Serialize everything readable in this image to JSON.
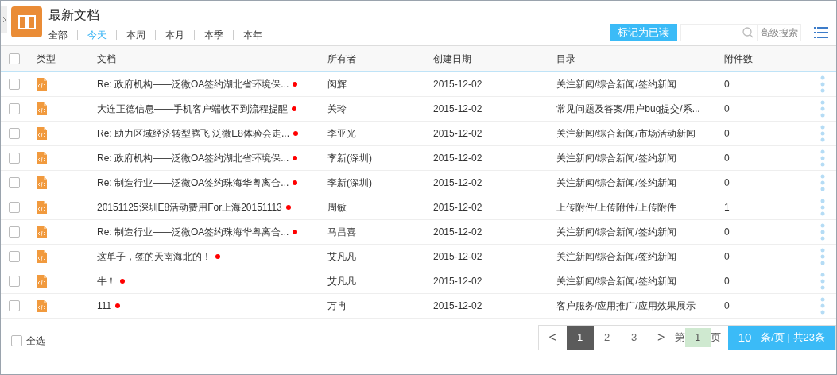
{
  "header": {
    "title": "最新文档",
    "filters": [
      {
        "label": "全部",
        "selected": false
      },
      {
        "label": "今天",
        "selected": true
      },
      {
        "label": "本周",
        "selected": false
      },
      {
        "label": "本月",
        "selected": false
      },
      {
        "label": "本季",
        "selected": false
      },
      {
        "label": "本年",
        "selected": false
      }
    ],
    "mark_read_button": "标记为已读",
    "advanced_search": "高级搜索"
  },
  "table": {
    "select_all_checked": false,
    "columns": [
      "类型",
      "文档",
      "所有者",
      "创建日期",
      "目录",
      "附件数"
    ],
    "rows": [
      {
        "checked": false,
        "title": "Re: 政府机构——泛微OA签约湖北省环境保...",
        "unread": true,
        "owner": "闵辉",
        "date": "2015-12-02",
        "directory": "关注新闻/综合新闻/签约新闻",
        "attachments": "0"
      },
      {
        "checked": false,
        "title": "大连正德信息——手机客户端收不到流程提醒",
        "unread": true,
        "owner": "关玲",
        "date": "2015-12-02",
        "directory": "常见问题及答案/用户bug提交/系...",
        "attachments": "0"
      },
      {
        "checked": false,
        "title": "Re: 助力区域经济转型腾飞 泛微E8体验会走...",
        "unread": true,
        "owner": "李亚光",
        "date": "2015-12-02",
        "directory": "关注新闻/综合新闻/市场活动新闻",
        "attachments": "0"
      },
      {
        "checked": false,
        "title": "Re: 政府机构——泛微OA签约湖北省环境保...",
        "unread": true,
        "owner": "李新(深圳)",
        "date": "2015-12-02",
        "directory": "关注新闻/综合新闻/签约新闻",
        "attachments": "0"
      },
      {
        "checked": false,
        "title": "Re: 制造行业——泛微OA签约珠海华粤离合...",
        "unread": true,
        "owner": "李新(深圳)",
        "date": "2015-12-02",
        "directory": "关注新闻/综合新闻/签约新闻",
        "attachments": "0"
      },
      {
        "checked": false,
        "title": "20151125深圳E8活动费用For上海20151113",
        "unread": true,
        "owner": "周敏",
        "date": "2015-12-02",
        "directory": "上传附件/上传附件/上传附件",
        "attachments": "1"
      },
      {
        "checked": false,
        "title": "Re: 制造行业——泛微OA签约珠海华粤离合...",
        "unread": true,
        "owner": "马昌喜",
        "date": "2015-12-02",
        "directory": "关注新闻/综合新闻/签约新闻",
        "attachments": "0"
      },
      {
        "checked": false,
        "title": "这单子，签的天南海北的！",
        "unread": true,
        "owner": "艾凡凡",
        "date": "2015-12-02",
        "directory": "关注新闻/综合新闻/签约新闻",
        "attachments": "0"
      },
      {
        "checked": false,
        "title": "牛！",
        "unread": true,
        "owner": "艾凡凡",
        "date": "2015-12-02",
        "directory": "关注新闻/综合新闻/签约新闻",
        "attachments": "0"
      },
      {
        "checked": false,
        "title": "111",
        "unread": true,
        "owner": "万冉",
        "date": "2015-12-02",
        "directory": "客户服务/应用推广/应用效果展示",
        "attachments": "0"
      }
    ]
  },
  "footer": {
    "select_all": {
      "label": "全选",
      "checked": false
    },
    "pagination": {
      "prev": "<",
      "pages": [
        {
          "label": "1",
          "selected": true
        },
        {
          "label": "2",
          "selected": false
        },
        {
          "label": "3",
          "selected": false
        }
      ],
      "next": ">",
      "page_prefix": "第",
      "page_value": "1",
      "page_suffix": "页",
      "page_size": "10",
      "summary": "条/页 | 共23条"
    }
  }
}
